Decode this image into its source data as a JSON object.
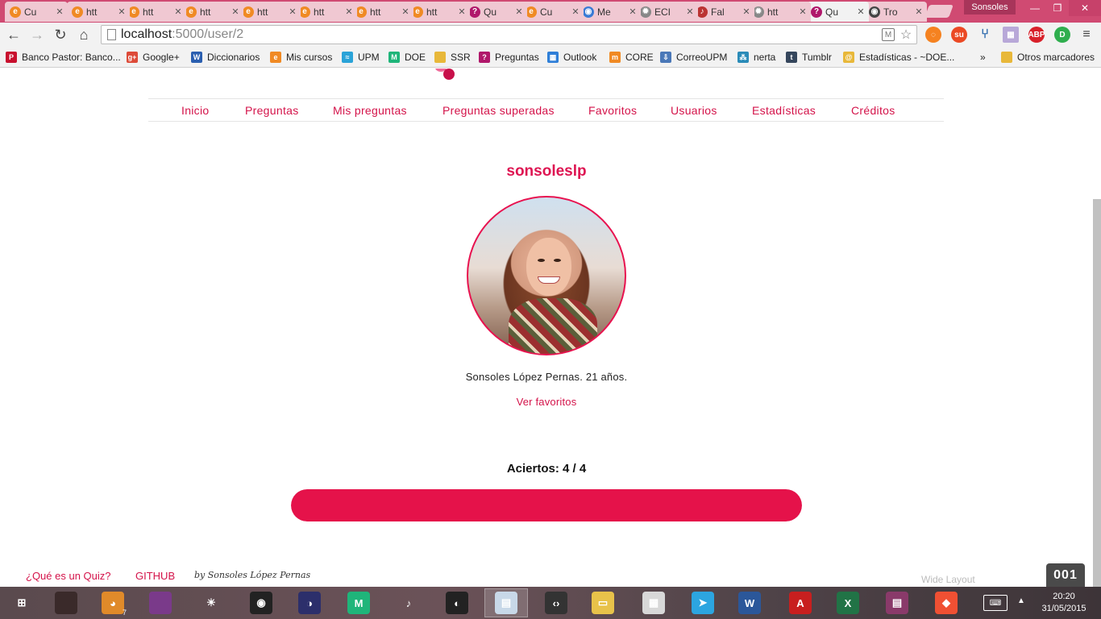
{
  "browser": {
    "tabs": [
      {
        "label": "Cu",
        "icon": "quiz-favicon",
        "color": "#f08a24",
        "glyph": "e"
      },
      {
        "label": "htt",
        "icon": "quiz-favicon",
        "color": "#f08a24",
        "glyph": "e"
      },
      {
        "label": "htt",
        "icon": "quiz-favicon",
        "color": "#f08a24",
        "glyph": "e"
      },
      {
        "label": "htt",
        "icon": "quiz-favicon",
        "color": "#f08a24",
        "glyph": "e"
      },
      {
        "label": "htt",
        "icon": "quiz-favicon",
        "color": "#f08a24",
        "glyph": "e"
      },
      {
        "label": "htt",
        "icon": "quiz-favicon",
        "color": "#f08a24",
        "glyph": "e"
      },
      {
        "label": "htt",
        "icon": "quiz-favicon",
        "color": "#f08a24",
        "glyph": "e"
      },
      {
        "label": "htt",
        "icon": "quiz-favicon",
        "color": "#f08a24",
        "glyph": "e"
      },
      {
        "label": "Qu",
        "icon": "question-favicon",
        "color": "#b0186b",
        "glyph": "?"
      },
      {
        "label": "Cu",
        "icon": "quiz-favicon",
        "color": "#f08a24",
        "glyph": "e"
      },
      {
        "label": "Me",
        "icon": "messenger-favicon",
        "color": "#3a7bd5",
        "glyph": "◉"
      },
      {
        "label": "ECI",
        "icon": "gear-favicon",
        "color": "#888888",
        "glyph": "✹"
      },
      {
        "label": "Fal",
        "icon": "guitar-favicon",
        "color": "#b33",
        "glyph": "♪"
      },
      {
        "label": "htt",
        "icon": "gear-favicon",
        "color": "#888888",
        "glyph": "✹"
      },
      {
        "label": "Qu",
        "icon": "question-favicon",
        "color": "#b0186b",
        "glyph": "?"
      },
      {
        "label": "Tro",
        "icon": "eye-favicon",
        "color": "#444444",
        "glyph": "◉"
      }
    ],
    "active_tab_index": 14,
    "profile_name": "Sonsoles",
    "url_host": "localhost",
    "url_path": ":5000/user/2",
    "bookmarks": [
      {
        "label": "Banco Pastor: Banco...",
        "icon": "banco-pastor-icon",
        "color": "#c8102e",
        "glyph": "P"
      },
      {
        "label": "Google+",
        "icon": "google-plus-icon",
        "color": "#dd4b39",
        "glyph": "g+"
      },
      {
        "label": "Diccionarios",
        "icon": "wordreference-icon",
        "color": "#2b5fb0",
        "glyph": "W"
      },
      {
        "label": "Mis cursos",
        "icon": "moodle-icon",
        "color": "#f08a24",
        "glyph": "e"
      },
      {
        "label": "UPM",
        "icon": "upm-icon",
        "color": "#2aa3d8",
        "glyph": "≈"
      },
      {
        "label": "DOE",
        "icon": "doe-icon",
        "color": "#1fb57a",
        "glyph": "M"
      },
      {
        "label": "SSR",
        "icon": "folder-icon",
        "color": "#e8b83a",
        "glyph": ""
      },
      {
        "label": "Preguntas",
        "icon": "question-icon",
        "color": "#b0186b",
        "glyph": "?"
      },
      {
        "label": "Outlook",
        "icon": "windows-icon",
        "color": "#2f7fd8",
        "glyph": "▦"
      },
      {
        "label": "CORE",
        "icon": "moodle-icon",
        "color": "#f08a24",
        "glyph": "m"
      },
      {
        "label": "CorreoUPM",
        "icon": "download-icon",
        "color": "#4a78b8",
        "glyph": "⇩"
      },
      {
        "label": "nerta",
        "icon": "dna-icon",
        "color": "#2a8bb8",
        "glyph": "⁂"
      },
      {
        "label": "Tumblr",
        "icon": "tumblr-icon",
        "color": "#35465c",
        "glyph": "t"
      },
      {
        "label": "Estadísticas - ~DOE...",
        "icon": "stats-icon",
        "color": "#e8b83a",
        "glyph": "@"
      }
    ],
    "bookmarks_overflow": "»",
    "other_bookmarks": "Otros marcadores"
  },
  "site": {
    "nav": [
      "Inicio",
      "Preguntas",
      "Mis preguntas",
      "Preguntas superadas",
      "Favoritos",
      "Usuarios",
      "Estadísticas",
      "Créditos"
    ],
    "username": "sonsoleslp",
    "bio": "Sonsoles López Pernas. 21 años.",
    "favorites_link": "Ver favoritos",
    "score_label": "Aciertos: 4 / 4",
    "score_fraction": 1.0,
    "footer": {
      "what_is_quiz": "¿Qué es un Quiz?",
      "github": "GITHUB",
      "signature": "by Sonsoles López Pernas"
    },
    "wide_layout": "Wide Layout",
    "counter": "001",
    "accent_color": "#e5124a"
  },
  "taskbar": {
    "apps": [
      {
        "name": "start-button",
        "glyph": "⊞",
        "color": "transparent"
      },
      {
        "name": "user-photo-app",
        "glyph": "",
        "color": "#3a2a2a"
      },
      {
        "name": "paint-app",
        "glyph": "◕",
        "color": "#e08a2a",
        "badge": "7"
      },
      {
        "name": "galaxy-app",
        "glyph": "",
        "color": "#7a3a8a"
      },
      {
        "name": "brightness-app",
        "glyph": "☀",
        "color": "transparent"
      },
      {
        "name": "vinyl-app",
        "glyph": "◉",
        "color": "#222"
      },
      {
        "name": "eclipse-app",
        "glyph": "◑",
        "color": "#2c2f6b"
      },
      {
        "name": "doe-app",
        "glyph": "M",
        "color": "#1fb57a"
      },
      {
        "name": "guitar-app",
        "glyph": "♪",
        "color": "transparent"
      },
      {
        "name": "firefox-app",
        "glyph": "◐",
        "color": "#222"
      },
      {
        "name": "chrome-window-app",
        "glyph": "▤",
        "color": "#c8d8e8"
      },
      {
        "name": "code-editor-app",
        "glyph": "‹›",
        "color": "#333"
      },
      {
        "name": "explorer-app",
        "glyph": "▭",
        "color": "#e8c24a"
      },
      {
        "name": "calculator-app",
        "glyph": "▦",
        "color": "#d8d8d8"
      },
      {
        "name": "telegram-app",
        "glyph": "➤",
        "color": "#2ca5e0"
      },
      {
        "name": "word-app",
        "glyph": "W",
        "color": "#2b579a"
      },
      {
        "name": "acrobat-app",
        "glyph": "A",
        "color": "#c81f1f"
      },
      {
        "name": "excel-app",
        "glyph": "X",
        "color": "#217346"
      },
      {
        "name": "winrar-app",
        "glyph": "▤",
        "color": "#8a3a6a"
      },
      {
        "name": "git-app",
        "glyph": "◆",
        "color": "#f05033"
      }
    ],
    "time": "20:20",
    "date": "31/05/2015"
  }
}
